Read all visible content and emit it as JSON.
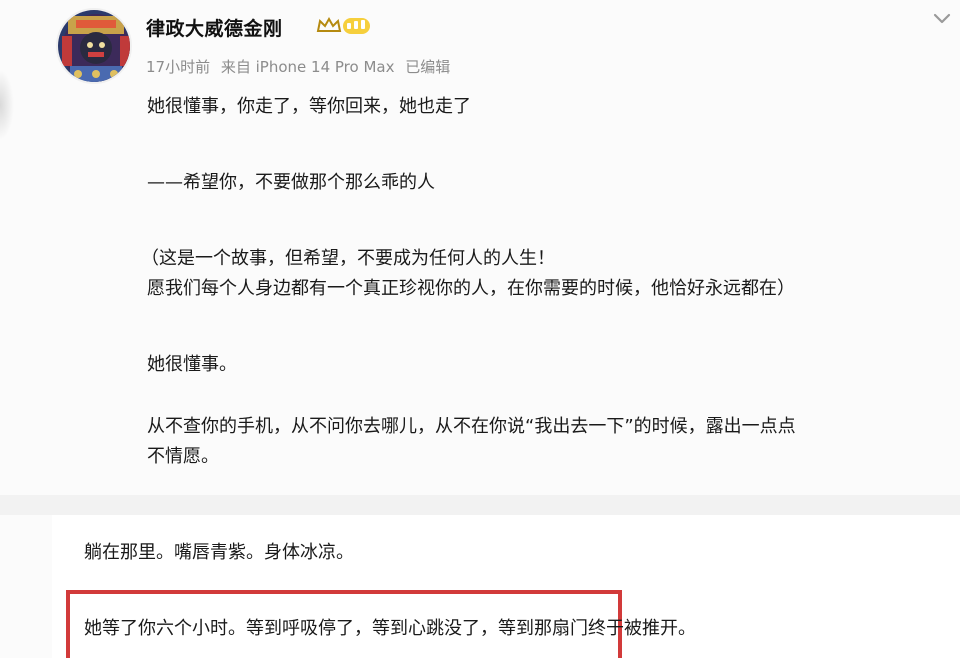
{
  "post": {
    "username": "律政大威德金刚",
    "meta": {
      "time": "17小时前",
      "source": "来自 iPhone 14 Pro Max",
      "edited": "已编辑"
    },
    "lines": [
      "她很懂事，你走了，等你回来，她也走了",
      "——希望你，不要做那个那么乖的人",
      "（这是一个故事，但希望，不要成为任何人的人生！",
      "愿我们每个人身边都有一个真正珍视你的人，在你需要的时候，他恰好永远都在）",
      "她很懂事。",
      "从不查你的手机，从不问你去哪儿，从不在你说“我出去一下”的时候，露出一点点",
      "不情愿。"
    ]
  },
  "lower": {
    "line1": "躺在那里。嘴唇青紫。身体冰凉。",
    "line2": "她等了你六个小时。等到呼吸停了，等到心跳没了，等到那扇门终于被推开。"
  },
  "colors": {
    "highlight_border": "#d23a3a",
    "vip_gold": "#e0b020",
    "meta_gray": "#8c8c8c"
  },
  "icons": {
    "avatar": "avatar-illustration",
    "vip": "vip-crown-badge-icon",
    "more": "chevron-down-icon"
  }
}
